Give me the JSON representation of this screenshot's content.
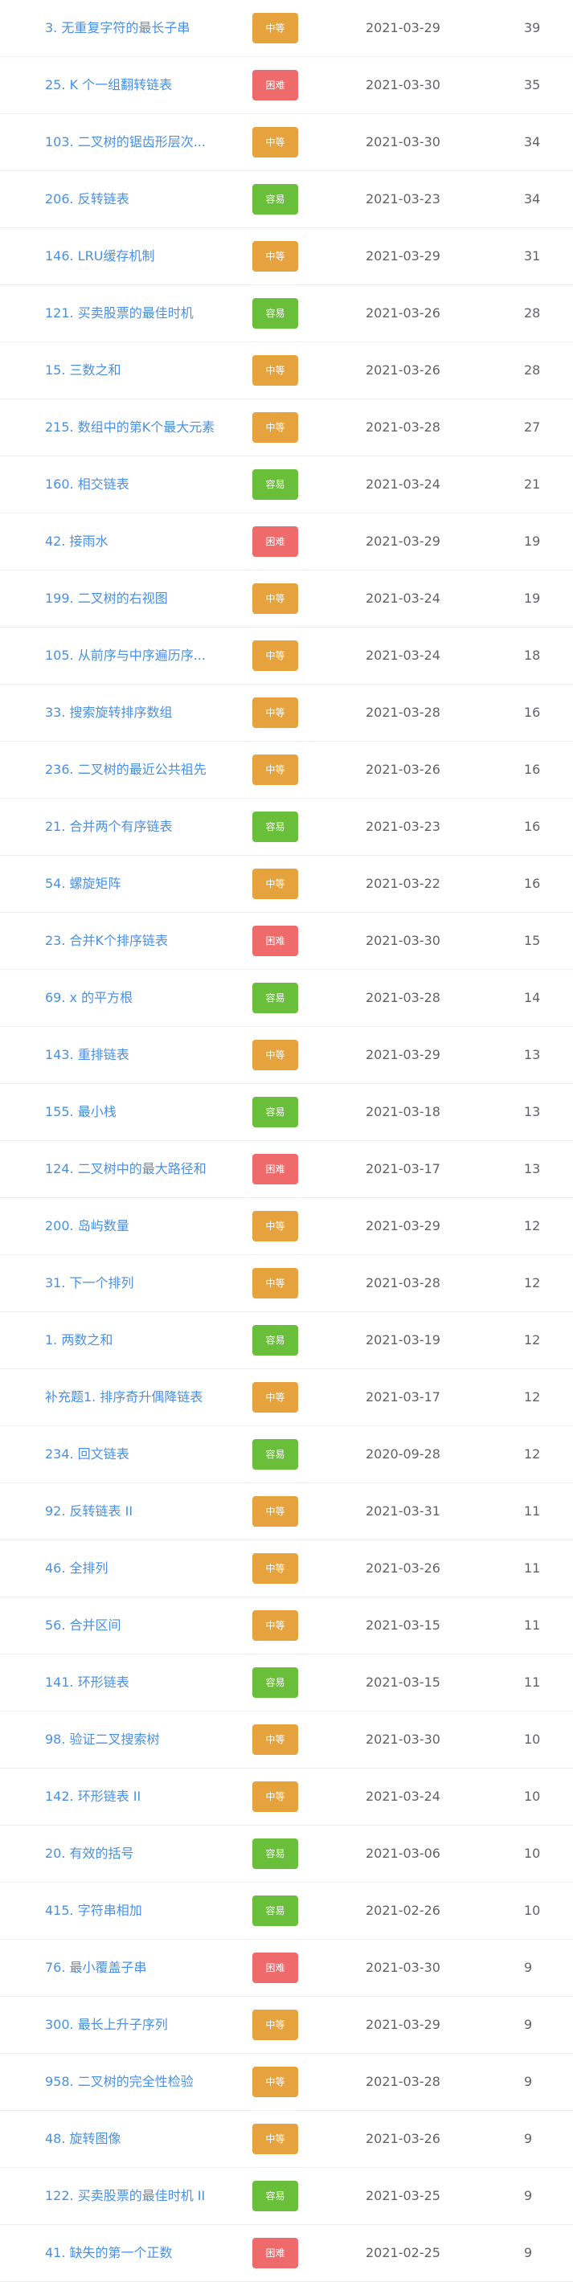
{
  "difficulty_colors": {
    "中等": "#e6a23c",
    "困难": "#ef6b6b",
    "容易": "#6abf3a"
  },
  "rows": [
    {
      "title": "3. 无重复字符的最长子串",
      "difficulty": "中等",
      "date": "2021-03-29",
      "count": "39"
    },
    {
      "title": "25. K 个一组翻转链表",
      "difficulty": "困难",
      "date": "2021-03-30",
      "count": "35"
    },
    {
      "title": "103. 二叉树的锯齿形层次...",
      "difficulty": "中等",
      "date": "2021-03-30",
      "count": "34"
    },
    {
      "title": "206. 反转链表",
      "difficulty": "容易",
      "date": "2021-03-23",
      "count": "34"
    },
    {
      "title": "146. LRU缓存机制",
      "difficulty": "中等",
      "date": "2021-03-29",
      "count": "31"
    },
    {
      "title": "121. 买卖股票的最佳时机",
      "difficulty": "容易",
      "date": "2021-03-26",
      "count": "28"
    },
    {
      "title": "15. 三数之和",
      "difficulty": "中等",
      "date": "2021-03-26",
      "count": "28"
    },
    {
      "title": "215. 数组中的第K个最大元素",
      "difficulty": "中等",
      "date": "2021-03-28",
      "count": "27"
    },
    {
      "title": "160. 相交链表",
      "difficulty": "容易",
      "date": "2021-03-24",
      "count": "21"
    },
    {
      "title": "42. 接雨水",
      "difficulty": "困难",
      "date": "2021-03-29",
      "count": "19"
    },
    {
      "title": "199. 二叉树的右视图",
      "difficulty": "中等",
      "date": "2021-03-24",
      "count": "19"
    },
    {
      "title": "105. 从前序与中序遍历序...",
      "difficulty": "中等",
      "date": "2021-03-24",
      "count": "18"
    },
    {
      "title": "33. 搜索旋转排序数组",
      "difficulty": "中等",
      "date": "2021-03-28",
      "count": "16"
    },
    {
      "title": "236. 二叉树的最近公共祖先",
      "difficulty": "中等",
      "date": "2021-03-26",
      "count": "16"
    },
    {
      "title": "21. 合并两个有序链表",
      "difficulty": "容易",
      "date": "2021-03-23",
      "count": "16"
    },
    {
      "title": "54. 螺旋矩阵",
      "difficulty": "中等",
      "date": "2021-03-22",
      "count": "16"
    },
    {
      "title": "23. 合并K个排序链表",
      "difficulty": "困难",
      "date": "2021-03-30",
      "count": "15"
    },
    {
      "title": "69. x 的平方根",
      "difficulty": "容易",
      "date": "2021-03-28",
      "count": "14"
    },
    {
      "title": "143. 重排链表",
      "difficulty": "中等",
      "date": "2021-03-29",
      "count": "13"
    },
    {
      "title": "155. 最小栈",
      "difficulty": "容易",
      "date": "2021-03-18",
      "count": "13"
    },
    {
      "title": "124. 二叉树中的最大路径和",
      "difficulty": "困难",
      "date": "2021-03-17",
      "count": "13"
    },
    {
      "title": "200. 岛屿数量",
      "difficulty": "中等",
      "date": "2021-03-29",
      "count": "12"
    },
    {
      "title": "31. 下一个排列",
      "difficulty": "中等",
      "date": "2021-03-28",
      "count": "12"
    },
    {
      "title": "1. 两数之和",
      "difficulty": "容易",
      "date": "2021-03-19",
      "count": "12"
    },
    {
      "title": "补充题1. 排序奇升偶降链表",
      "difficulty": "中等",
      "date": "2021-03-17",
      "count": "12"
    },
    {
      "title": "234. 回文链表",
      "difficulty": "容易",
      "date": "2020-09-28",
      "count": "12"
    },
    {
      "title": "92. 反转链表 II",
      "difficulty": "中等",
      "date": "2021-03-31",
      "count": "11"
    },
    {
      "title": "46. 全排列",
      "difficulty": "中等",
      "date": "2021-03-26",
      "count": "11"
    },
    {
      "title": "56. 合并区间",
      "difficulty": "中等",
      "date": "2021-03-15",
      "count": "11"
    },
    {
      "title": "141. 环形链表",
      "difficulty": "容易",
      "date": "2021-03-15",
      "count": "11"
    },
    {
      "title": "98. 验证二叉搜索树",
      "difficulty": "中等",
      "date": "2021-03-30",
      "count": "10"
    },
    {
      "title": "142. 环形链表 II",
      "difficulty": "中等",
      "date": "2021-03-24",
      "count": "10"
    },
    {
      "title": "20. 有效的括号",
      "difficulty": "容易",
      "date": "2021-03-06",
      "count": "10"
    },
    {
      "title": "415. 字符串相加",
      "difficulty": "容易",
      "date": "2021-02-26",
      "count": "10"
    },
    {
      "title": "76. 最小覆盖子串",
      "difficulty": "困难",
      "date": "2021-03-30",
      "count": "9"
    },
    {
      "title": "300. 最长上升子序列",
      "difficulty": "中等",
      "date": "2021-03-29",
      "count": "9"
    },
    {
      "title": "958. 二叉树的完全性检验",
      "difficulty": "中等",
      "date": "2021-03-28",
      "count": "9"
    },
    {
      "title": "48. 旋转图像",
      "difficulty": "中等",
      "date": "2021-03-26",
      "count": "9"
    },
    {
      "title": "122. 买卖股票的最佳时机 II",
      "difficulty": "容易",
      "date": "2021-03-25",
      "count": "9"
    },
    {
      "title": "41. 缺失的第一个正数",
      "difficulty": "困难",
      "date": "2021-02-25",
      "count": "9"
    }
  ]
}
